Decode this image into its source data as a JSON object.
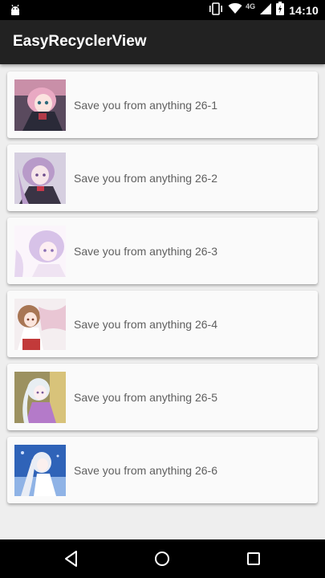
{
  "status_bar": {
    "network_label": "4G",
    "time": "14:10",
    "icons": [
      "android-debug-icon",
      "vibrate-icon",
      "wifi-icon",
      "signal-icon",
      "battery-icon"
    ]
  },
  "app_bar": {
    "title": "EasyRecyclerView"
  },
  "list": {
    "items": [
      {
        "label": "Save you from anything 26-1"
      },
      {
        "label": "Save you from anything 26-2"
      },
      {
        "label": "Save you from anything 26-3"
      },
      {
        "label": "Save you from anything 26-4"
      },
      {
        "label": "Save you from anything 26-5"
      },
      {
        "label": "Save you from anything 26-6"
      }
    ]
  },
  "nav_bar": {
    "buttons": [
      "back-icon",
      "home-icon",
      "recents-icon"
    ]
  }
}
